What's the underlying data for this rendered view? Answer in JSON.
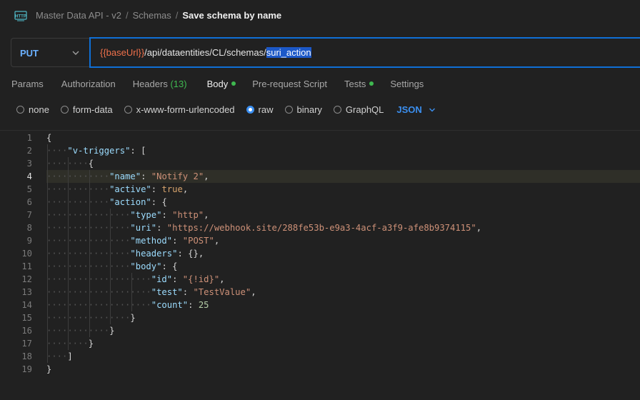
{
  "breadcrumb": {
    "collection": "Master Data API - v2",
    "folder": "Schemas",
    "request": "Save schema by name",
    "separator": "/"
  },
  "request": {
    "method": "PUT",
    "url_variable": "{{baseUrl}}",
    "url_path": "/api/dataentities/CL/schemas/",
    "url_selected": "suri_action"
  },
  "tabs": [
    {
      "label": "Params"
    },
    {
      "label": "Authorization"
    },
    {
      "label": "Headers",
      "count": "(13)"
    },
    {
      "label": "Body",
      "active": true,
      "dot": true
    },
    {
      "label": "Pre-request Script"
    },
    {
      "label": "Tests",
      "dot": true
    },
    {
      "label": "Settings"
    }
  ],
  "body_modes": {
    "options": [
      "none",
      "form-data",
      "x-www-form-urlencoded",
      "raw",
      "binary",
      "GraphQL"
    ],
    "selected": "raw",
    "language": "JSON"
  },
  "editor": {
    "current_line": 4,
    "lines": [
      "{",
      "  \"v-triggers\": [",
      "    {",
      "      \"name\": \"Notify 2\",",
      "      \"active\": true,",
      "      \"action\": {",
      "        \"type\": \"http\",",
      "        \"uri\": \"https://webhook.site/288fe53b-e9a3-4acf-a3f9-afe8b9374115\",",
      "        \"method\": \"POST\",",
      "        \"headers\": {},",
      "        \"body\": {",
      "          \"id\": \"{!id}\",",
      "          \"test\": \"TestValue\",",
      "          \"count\": 25",
      "        }",
      "      }",
      "    }",
      "  ]",
      "}"
    ]
  },
  "colors": {
    "background": "#212121",
    "accent": "#0f6fd6",
    "method": "#6bb1ff",
    "variable": "#f0714b",
    "status_dot": "#3fb950"
  }
}
